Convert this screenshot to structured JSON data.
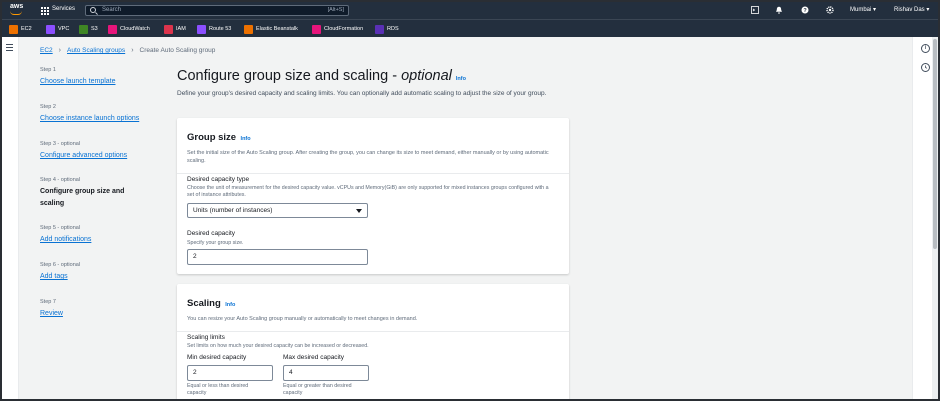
{
  "topnav": {
    "logo": "aws",
    "services": "Services",
    "search_placeholder": "Search",
    "search_shortcut": "[Alt+S]",
    "region": "Mumbai ▾",
    "user": "Rishav Das ▾",
    "icons": [
      "cloudshell-icon",
      "bell-icon",
      "help-icon",
      "settings-icon"
    ]
  },
  "favorites": [
    {
      "label": "EC2",
      "color": "#ed7100"
    },
    {
      "label": "VPC",
      "color": "#8c4fff"
    },
    {
      "label": "S3",
      "color": "#3f8624"
    },
    {
      "label": "CloudWatch",
      "color": "#e7157b"
    },
    {
      "label": "IAM",
      "color": "#dd344c"
    },
    {
      "label": "Route 53",
      "color": "#8c4fff"
    },
    {
      "label": "Elastic Beanstalk",
      "color": "#ed7100"
    },
    {
      "label": "CloudFormation",
      "color": "#e7157b"
    },
    {
      "label": "RDS",
      "color": "#5a30b5"
    }
  ],
  "breadcrumb": {
    "items": [
      "EC2",
      "Auto Scaling groups"
    ],
    "current": "Create Auto Scaling group"
  },
  "steps": [
    {
      "num": "Step 1",
      "label": "Choose launch template"
    },
    {
      "num": "Step 2",
      "label": "Choose instance launch options"
    },
    {
      "num": "Step 3 - optional",
      "label": "Configure advanced options"
    },
    {
      "num": "Step 4 - optional",
      "label": "Configure group size and scaling"
    },
    {
      "num": "Step 5 - optional",
      "label": "Add notifications"
    },
    {
      "num": "Step 6 - optional",
      "label": "Add tags"
    },
    {
      "num": "Step 7",
      "label": "Review"
    }
  ],
  "page": {
    "title": "Configure group size and scaling -",
    "title_italic": "optional",
    "info": "Info",
    "description": "Define your group's desired capacity and scaling limits. You can optionally add automatic scaling to adjust the size of your group."
  },
  "group_size": {
    "title": "Group size",
    "info": "Info",
    "description": "Set the initial size of the Auto Scaling group. After creating the group, you can change its size to meet demand, either manually or by using automatic scaling.",
    "capacity_type_label": "Desired capacity type",
    "capacity_type_desc": "Choose the unit of measurement for the desired capacity value. vCPUs and Memory(GiB) are only supported for mixed instances groups configured with a set of instance attributes.",
    "capacity_type_value": "Units (number of instances)",
    "desired_label": "Desired capacity",
    "desired_desc": "Specify your group size.",
    "desired_value": "2"
  },
  "scaling": {
    "title": "Scaling",
    "info": "Info",
    "description": "You can resize your Auto Scaling group manually or automatically to meet changes in demand.",
    "limits_label": "Scaling limits",
    "limits_desc": "Set limits on how much your desired capacity can be increased or decreased.",
    "min_label": "Min desired capacity",
    "min_value": "2",
    "min_hint": "Equal or less than desired capacity",
    "max_label": "Max desired capacity",
    "max_value": "4",
    "max_hint": "Equal or greater than desired capacity"
  }
}
